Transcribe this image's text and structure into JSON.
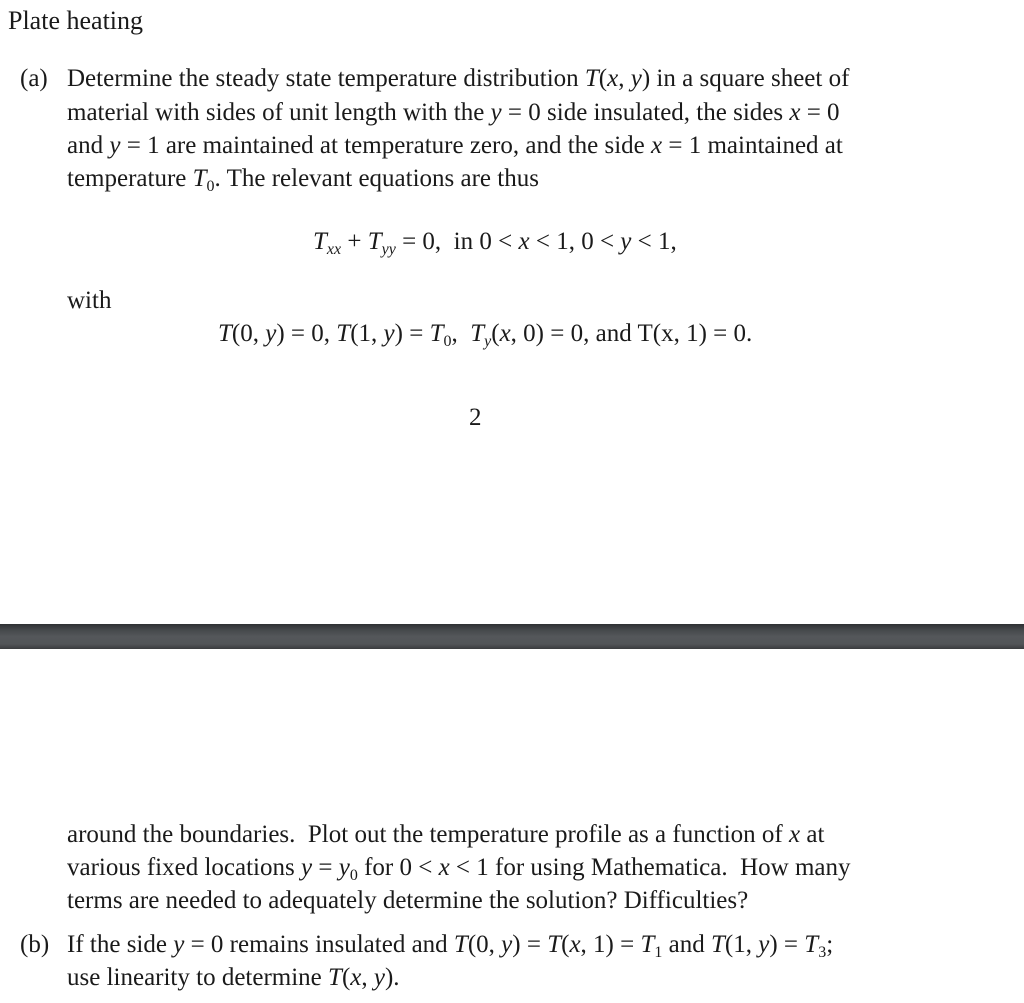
{
  "title": "Plate heating",
  "part_a": {
    "label": "(a)",
    "lines": [
      "Determine the steady state temperature distribution",
      "in a square sheet of",
      "material with sides of unit length with the",
      "side insulated, the sides",
      "and",
      "are maintained at temperature zero, and the side",
      "maintained at",
      "temperature",
      ". The relevant equations are thus"
    ],
    "math": {
      "Txy": "T(x, y)",
      "y0": "y = 0",
      "x0": "x = 0",
      "y1": "y = 1",
      "x1": "x = 1",
      "T0": "T"
    },
    "equation1": {
      "lhs": "T",
      "sub1": "xx",
      "plus": " + T",
      "sub2": "yy",
      "rest": " = 0,  in 0 < x < 1, 0 < y < 1,"
    },
    "with_label": "with",
    "equation2": "T(0, y) = 0, T(1, y) = T₀,  T_y(x, 0) = 0, and T(x, 1) = 0."
  },
  "page_number": "2",
  "continuation": {
    "line1": "around the boundaries. Plot out the temperature profile as a function of x at",
    "line2": "various fixed locations y = y₀ for 0 < x < 1 for using Mathematica. How many",
    "line3": "terms are needed to adequately determine the solution? Difficulties?"
  },
  "part_b": {
    "label": "(b)",
    "line1": "If the side y = 0 remains insulated and T(0, y) = T(x, 1) = T₁ and T(1, y) = T₃;",
    "line2": "use linearity to determine T(x, y)."
  }
}
